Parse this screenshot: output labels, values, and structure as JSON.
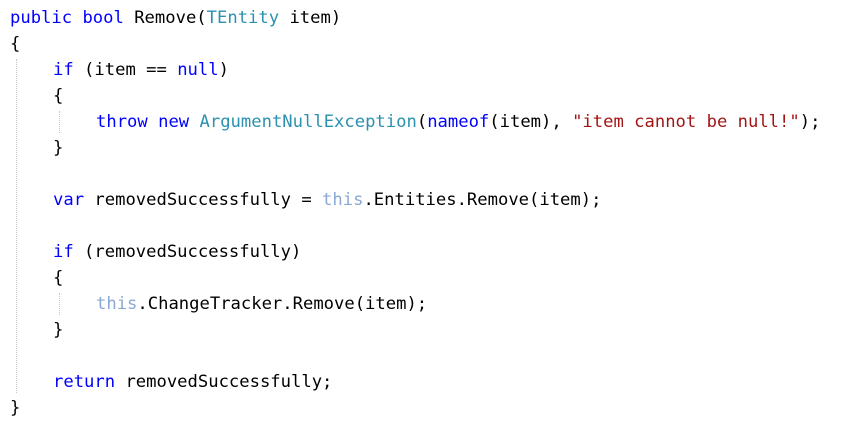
{
  "editor": {
    "lines": [
      {
        "indent": 0,
        "tokens": [
          {
            "t": "public",
            "k": "kw"
          },
          {
            "t": " ",
            "k": "plain"
          },
          {
            "t": "bool",
            "k": "kw"
          },
          {
            "t": " Remove(",
            "k": "plain"
          },
          {
            "t": "TEntity",
            "k": "type"
          },
          {
            "t": " item)",
            "k": "plain"
          }
        ]
      },
      {
        "indent": 0,
        "tokens": [
          {
            "t": "{",
            "k": "plain"
          }
        ]
      },
      {
        "indent": 1,
        "tokens": [
          {
            "t": "if",
            "k": "kw"
          },
          {
            "t": " (item == ",
            "k": "plain"
          },
          {
            "t": "null",
            "k": "kw"
          },
          {
            "t": ")",
            "k": "plain"
          }
        ]
      },
      {
        "indent": 1,
        "tokens": [
          {
            "t": "{",
            "k": "plain"
          }
        ]
      },
      {
        "indent": 2,
        "tokens": [
          {
            "t": "throw",
            "k": "kw"
          },
          {
            "t": " ",
            "k": "plain"
          },
          {
            "t": "new",
            "k": "kw"
          },
          {
            "t": " ",
            "k": "plain"
          },
          {
            "t": "ArgumentNullException",
            "k": "type"
          },
          {
            "t": "(",
            "k": "plain"
          },
          {
            "t": "nameof",
            "k": "kw"
          },
          {
            "t": "(item), ",
            "k": "plain"
          },
          {
            "t": "\"item cannot be null!\"",
            "k": "str"
          },
          {
            "t": ");",
            "k": "plain"
          }
        ]
      },
      {
        "indent": 1,
        "tokens": [
          {
            "t": "}",
            "k": "plain"
          }
        ]
      },
      {
        "indent": 0,
        "tokens": []
      },
      {
        "indent": 1,
        "tokens": [
          {
            "t": "var",
            "k": "kw"
          },
          {
            "t": " removedSuccessfully = ",
            "k": "plain"
          },
          {
            "t": "this",
            "k": "this"
          },
          {
            "t": ".Entities.Remove(item);",
            "k": "plain"
          }
        ]
      },
      {
        "indent": 0,
        "tokens": []
      },
      {
        "indent": 1,
        "tokens": [
          {
            "t": "if",
            "k": "kw"
          },
          {
            "t": " (removedSuccessfully)",
            "k": "plain"
          }
        ]
      },
      {
        "indent": 1,
        "tokens": [
          {
            "t": "{",
            "k": "plain"
          }
        ]
      },
      {
        "indent": 2,
        "tokens": [
          {
            "t": "this",
            "k": "this"
          },
          {
            "t": ".ChangeTracker.Remove(item);",
            "k": "plain"
          }
        ]
      },
      {
        "indent": 1,
        "tokens": [
          {
            "t": "}",
            "k": "plain"
          }
        ]
      },
      {
        "indent": 0,
        "tokens": []
      },
      {
        "indent": 1,
        "tokens": [
          {
            "t": "return",
            "k": "kw"
          },
          {
            "t": " removedSuccessfully;",
            "k": "plain"
          }
        ]
      },
      {
        "indent": 0,
        "tokens": [
          {
            "t": "}",
            "k": "plain"
          }
        ]
      }
    ],
    "colors": {
      "keyword": "#0000ff",
      "type": "#2b91af",
      "string": "#a31515",
      "this_keyword": "#8aa8d4",
      "plain": "#000000",
      "indent_guide": "#c6c6c6",
      "background": "#ffffff"
    }
  }
}
